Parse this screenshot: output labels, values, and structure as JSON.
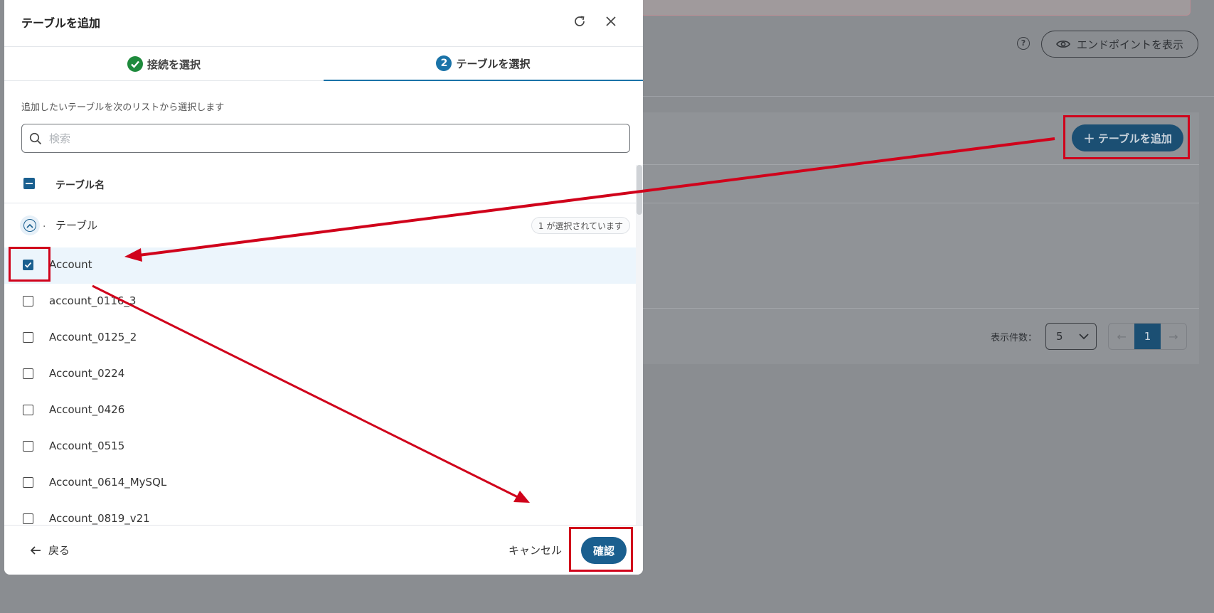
{
  "background": {
    "endpoint_button": "エンドポイントを表示",
    "add_table_button": "テーブルを追加",
    "page_size_label": "表示件数：",
    "page_size_value": "5",
    "current_page": "1"
  },
  "modal": {
    "title": "テーブルを追加",
    "steps": [
      {
        "label": "接続を選択",
        "state": "done"
      },
      {
        "label": "テーブルを選択",
        "number": "2",
        "state": "active"
      }
    ],
    "instruction": "追加したいテーブルを次のリストから選択します",
    "search_placeholder": "検索",
    "column_header": "テーブル名",
    "group": {
      "dot": ".",
      "label": "テーブル",
      "badge": "1 が選択されています"
    },
    "rows": [
      {
        "label": "Account",
        "checked": true
      },
      {
        "label": "account_0116_3",
        "checked": false
      },
      {
        "label": "Account_0125_2",
        "checked": false
      },
      {
        "label": "Account_0224",
        "checked": false
      },
      {
        "label": "Account_0426",
        "checked": false
      },
      {
        "label": "Account_0515",
        "checked": false
      },
      {
        "label": "Account_0614_MySQL",
        "checked": false
      },
      {
        "label": "Account_0819_v21",
        "checked": false
      }
    ],
    "footer": {
      "back": "戻る",
      "cancel": "キャンセル",
      "confirm": "確認"
    }
  },
  "colors": {
    "accent": "#1a5f8f",
    "annotation": "#d0021b",
    "success": "#1e8a3c"
  }
}
